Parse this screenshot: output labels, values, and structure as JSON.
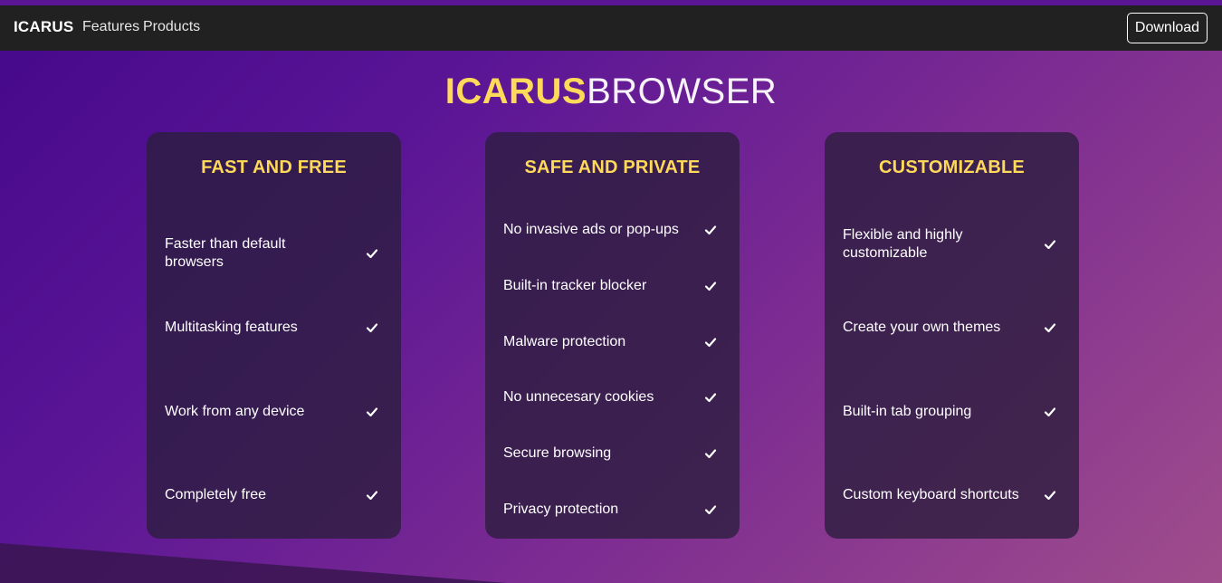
{
  "nav": {
    "brand": "ICARUS",
    "links": [
      "Features",
      "Products"
    ],
    "download_label": "Download"
  },
  "hero": {
    "title_part1": "ICARUS",
    "title_part2": "BROWSER"
  },
  "cards": [
    {
      "title": "FAST AND FREE",
      "features": [
        "Faster than default browsers",
        "Multitasking features",
        "Work from any device",
        "Completely free"
      ]
    },
    {
      "title": "SAFE AND PRIVATE",
      "features": [
        "No invasive ads or pop-ups",
        "Built-in tracker blocker",
        "Malware protection",
        "No unnecesary cookies",
        "Secure browsing",
        "Privacy protection"
      ]
    },
    {
      "title": "CUSTOMIZABLE",
      "features": [
        "Flexible and highly customizable",
        "Create your own themes",
        "Built-in tab grouping",
        "Custom keyboard shortcuts"
      ]
    }
  ],
  "icons": {
    "feature_check": "check-icon"
  },
  "colors": {
    "accent": "#ffd95a",
    "navbar": "#212121",
    "card": "#2a1e3c"
  }
}
